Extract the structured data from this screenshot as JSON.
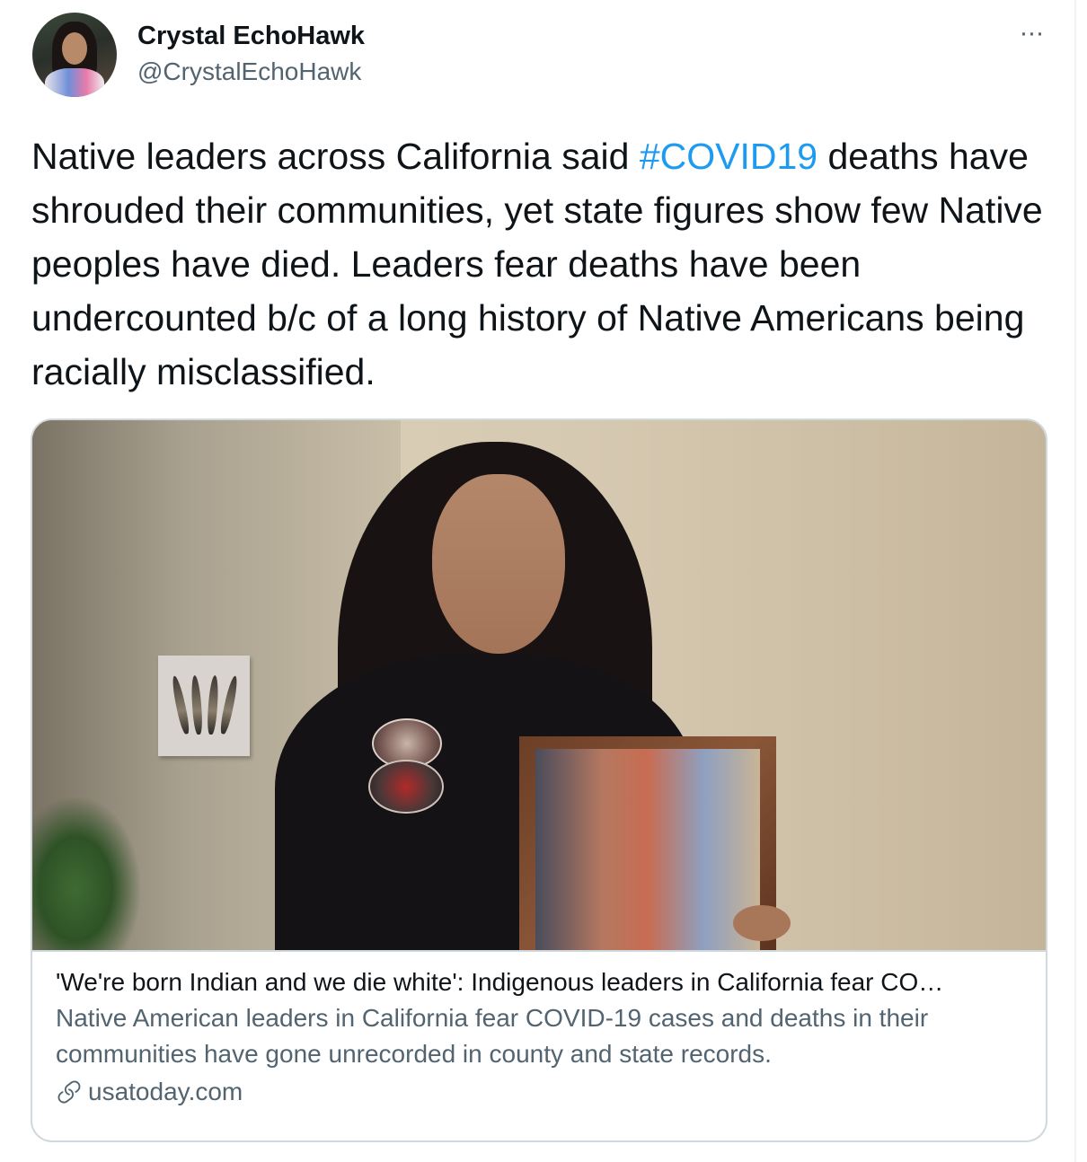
{
  "tweet": {
    "author_name": "Crystal EchoHawk",
    "author_handle": "@CrystalEchoHawk",
    "more_label": "···",
    "text_before": "Native leaders across California said ",
    "hashtag": "#COVID19",
    "text_after": " deaths have shrouded their communities, yet state figures show few Native peoples have died. Leaders fear deaths have been undercounted b/c of a long history of Native Americans being racially misclassified."
  },
  "card": {
    "title": "'We're born Indian and we die white': Indigenous leaders in California fear CO…",
    "description": "Native American leaders in California fear COVID-19 cases and deaths in their communities have gone unrecorded in county and state records.",
    "domain": "usatoday.com"
  },
  "colors": {
    "hashtag": "#1d9bf0",
    "secondary_text": "#536471",
    "border": "#cfd9de"
  },
  "icons": {
    "more": "more-options-icon",
    "link": "link-icon"
  }
}
